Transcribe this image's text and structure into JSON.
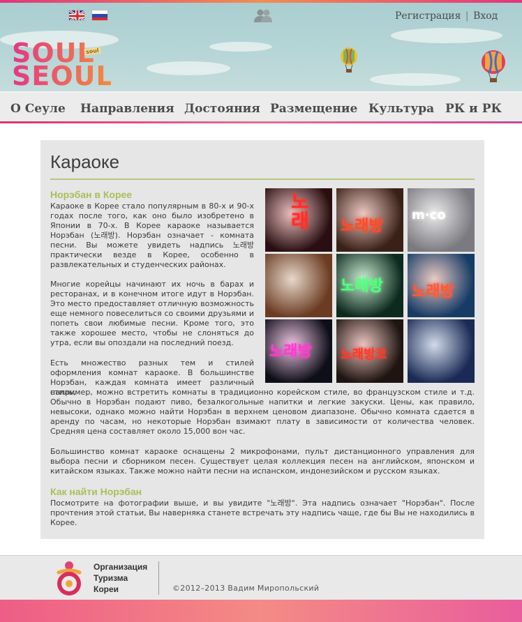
{
  "header": {
    "auth": {
      "register": "Регистрация",
      "separator": "|",
      "login": "Вход"
    },
    "logo": {
      "line1": "SOUL",
      "line2": "SEOUL",
      "tag": "soul"
    },
    "icons": [
      "uk-flag-icon",
      "russia-flag-icon",
      "users-icon",
      "balloon-icon"
    ]
  },
  "nav": {
    "items": [
      "О Сеуле",
      "Направления",
      "Достояния",
      "Размещение",
      "Культура",
      "РК и РК"
    ]
  },
  "main": {
    "title": "Караоке",
    "section1": {
      "heading": "Норэбан в Корее",
      "p1": "Караоке в Корее стало популярным в 80-х и 90-х годах после того, как оно было изобретено в Японии в 70-х. В Корее караоке называется Норэбан (노래방). Норэбан означает - комната песни. Вы можете увидеть надпись 노래방 практически везде в Корее, особенно в развлекательных и студенческих районах.",
      "p2": "Многие корейцы начинают их ночь в барах и ресторанах, и в конечном итоге идут в Норэбан. Это место предоставляет отличную возможность еще немного повеселиться со своими друзьями и попеть свои любимые песни. Кроме того, это также хорошее место, чтобы не слоняться до утра, если вы опоздали на последний поезд.",
      "p3a": "Есть множество разных тем и стилей оформления комнат караоке. В большинстве Норэбан, каждая комната имеет различный стиль,",
      "p3b": "например, можно встретить комнаты в традиционно корейском стиле, во французском стиле и т.д. Обычно в Норэбан подают пиво, безалкогольные напитки и легкие закуски. Цены, как правило, невысоки, однако можно найти Норэбан в верхнем ценовом диапазоне. Обычно комната сдается в аренду по часам, но некоторые Норэбан взимают плату в зависимости от количества человек. Средняя цена составляет около 15,000 вон час.",
      "p4": "Большинство комнат караоке оснащены 2 микрофонами, пульт дистанционного управления для выбора песни и сборником песен. Существует целая коллекция песен на английском, японском и китайском языках. Также можно найти песни на испанском, индонезийском и русском языках."
    },
    "section2": {
      "heading": "Как найти Норэбан",
      "p1": "Посмотрите на фотографии выше, и вы увидите \"노래방\". Эта надпись означает \"Норэбан\". После прочтения этой статьи, Вы наверняка станете встречать эту надпись чаще, где бы Вы не находились в Корее."
    },
    "photos": [
      {
        "sign": "노래",
        "bg": "#2a0f12",
        "fg": "#ff2f2a"
      },
      {
        "sign": "노래방",
        "bg": "#3a2118",
        "fg": "#ff4a2a"
      },
      {
        "sign": "m·co",
        "bg": "#7a7a80",
        "fg": "#ffffff"
      },
      {
        "sign": "",
        "bg": "#6b3b22",
        "fg": "#e7a35a"
      },
      {
        "sign": "노래방",
        "bg": "#0d2a1e",
        "fg": "#53ff7d"
      },
      {
        "sign": "노래방",
        "bg": "#163c66",
        "fg": "#ff5a36"
      },
      {
        "sign": "노래방",
        "bg": "#0e0e18",
        "fg": "#ff3ccf"
      },
      {
        "sign": "노래방코",
        "bg": "#1e1410",
        "fg": "#ff3a2a"
      },
      {
        "sign": "",
        "bg": "#1b2a55",
        "fg": "#7fb0ff"
      }
    ]
  },
  "footer": {
    "org": [
      "Организация",
      "Туризма",
      "Кореи"
    ],
    "copyright": "©2012–2013 Вадим Миропольский"
  }
}
